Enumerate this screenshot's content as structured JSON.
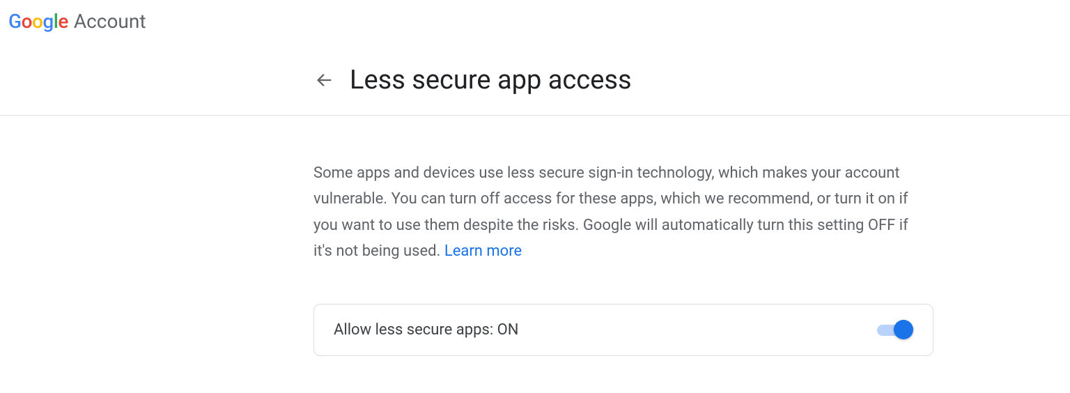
{
  "header": {
    "logo_text": "Google",
    "account_label": "Account"
  },
  "page": {
    "title": "Less secure app access",
    "description": "Some apps and devices use less secure sign-in technology, which makes your account vulnerable. You can turn off access for these apps, which we recommend, or turn it on if you want to use them despite the risks. Google will automatically turn this setting OFF if it's not being used. ",
    "learn_more": "Learn more"
  },
  "toggle": {
    "label": "Allow less secure apps: ON",
    "state": "on"
  }
}
